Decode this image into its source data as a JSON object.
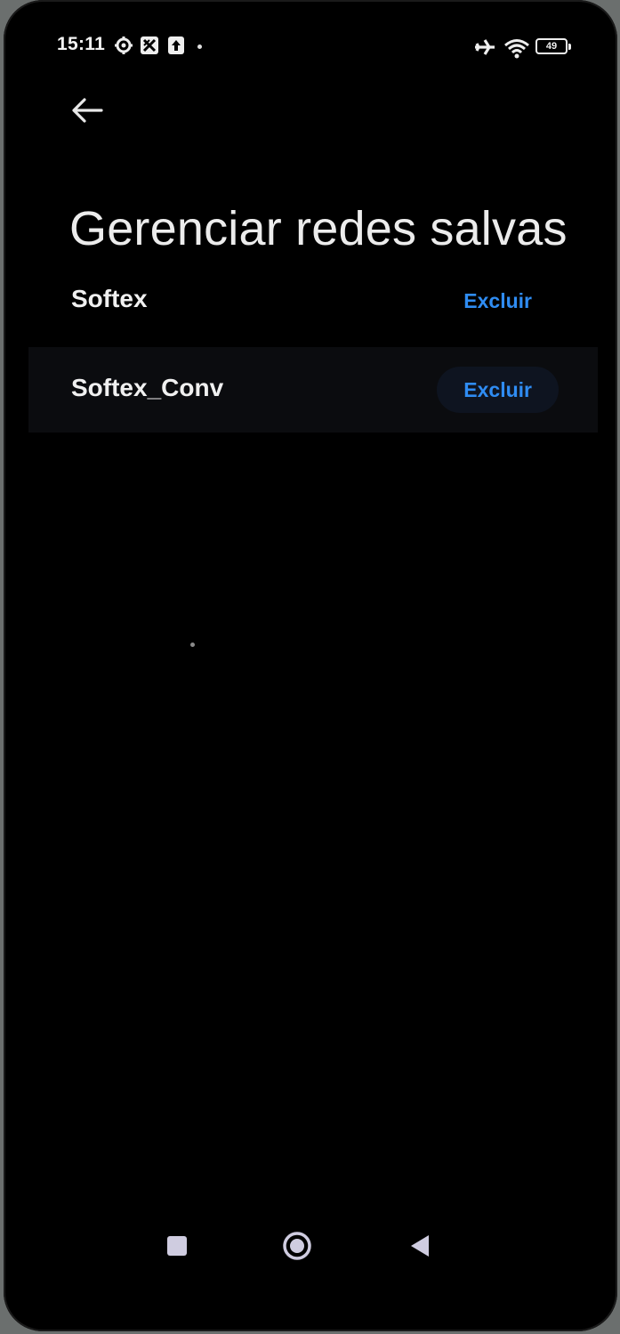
{
  "status_bar": {
    "time": "15:11",
    "icons": [
      "settings-gear-icon",
      "app-notification-icon",
      "upload-icon",
      "airplane-icon",
      "wifi-icon"
    ],
    "battery": "49"
  },
  "header": {
    "back_icon": "arrow-left-icon",
    "title": "Gerenciar redes salvas"
  },
  "networks": [
    {
      "name": "Softex",
      "action_label": "Excluir"
    },
    {
      "name": "Softex_Conv",
      "action_label": "Excluir"
    }
  ],
  "navigation": {
    "icons": [
      "recents-square-icon",
      "home-circle-icon",
      "back-triangle-icon"
    ]
  },
  "colors": {
    "background": "#000000",
    "accent": "#2f8cf2",
    "text": "#f0f0f0"
  }
}
